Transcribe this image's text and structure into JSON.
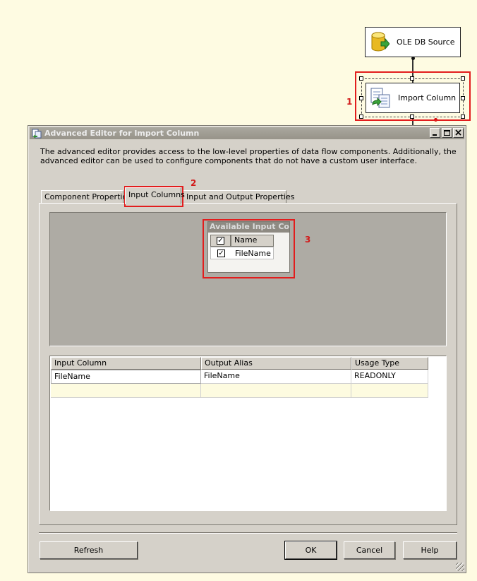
{
  "flow": {
    "source": {
      "label": "OLE DB Source",
      "icon": "database-cylinder-icon"
    },
    "import": {
      "label": "Import Column",
      "icon": "documents-import-icon"
    }
  },
  "annotations": [
    "1",
    "2",
    "3"
  ],
  "dialog": {
    "title": "Advanced Editor for Import Column",
    "description": "The advanced editor provides access to the low-level properties of data flow components. Additionally, the advanced editor can be used to configure components that do not have a custom user interface.",
    "tabs": [
      "Component Properties",
      "Input Columns",
      "Input and Output Properties"
    ],
    "active_tab": "Input Columns",
    "available": {
      "title": "Available Input Co...",
      "header": "Name",
      "rows": [
        {
          "name": "FileName",
          "checked": true
        }
      ]
    },
    "grid": {
      "columns": [
        "Input Column",
        "Output Alias",
        "Usage Type"
      ],
      "rows": [
        [
          "FileName",
          "FileName",
          "READONLY"
        ]
      ]
    },
    "buttons": {
      "refresh": "Refresh",
      "ok": "OK",
      "cancel": "Cancel",
      "help": "Help"
    }
  },
  "colors": {
    "canvas": "#fefbe2",
    "dialog": "#d5d1c9",
    "annotation": "#e21d1d",
    "new_row": "#fdfbe0"
  }
}
